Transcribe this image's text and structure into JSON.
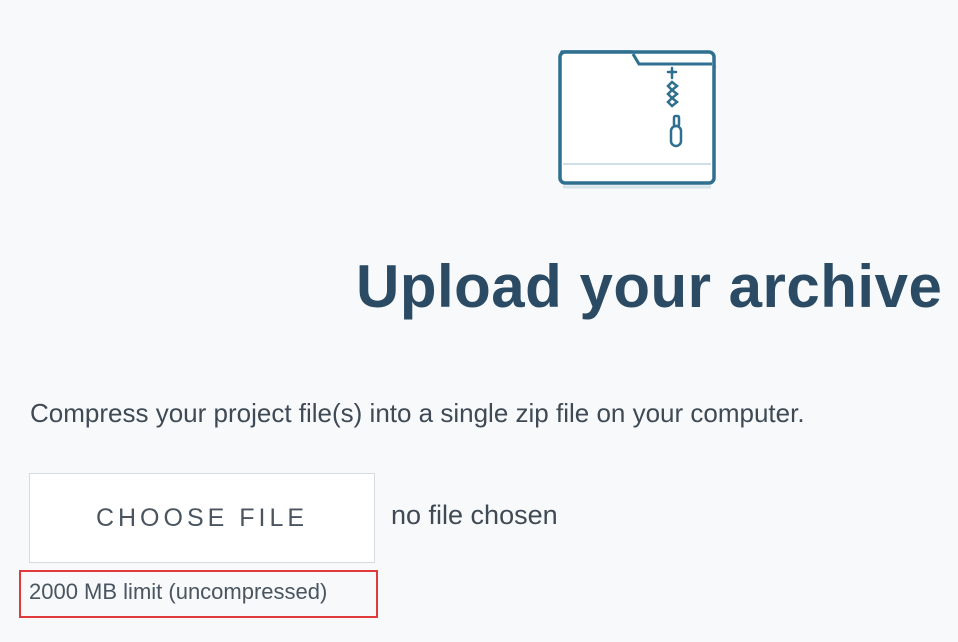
{
  "header": {
    "icon": "zip-archive-folder-icon",
    "title": "Upload your archive"
  },
  "main": {
    "instruction": "Compress your project file(s) into a single zip file on your computer.",
    "choose_file_label": "CHOOSE FILE",
    "file_status": "no file chosen",
    "limit_note": "2000 MB limit (uncompressed)"
  },
  "colors": {
    "title": "#2b4a63",
    "icon_stroke": "#2f6f8f",
    "highlight_border": "#e03a3a",
    "background": "#f7f9fb"
  }
}
